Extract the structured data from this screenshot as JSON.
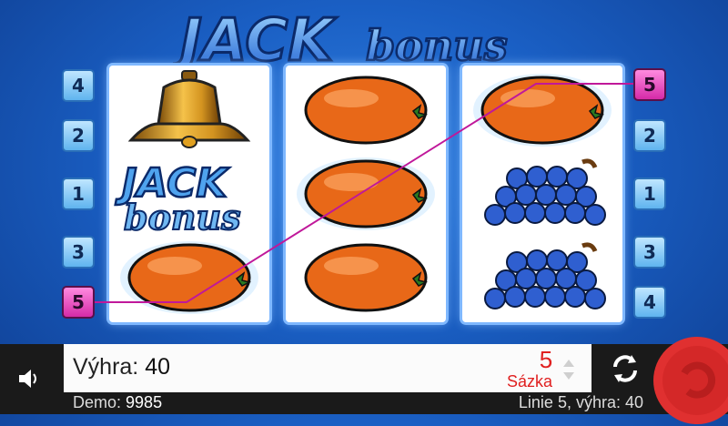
{
  "title": {
    "main": "JACK",
    "sub": "bonus"
  },
  "reels": [
    [
      "bell-icon",
      "jackbonus-logo",
      "orange-icon"
    ],
    [
      "orange-icon",
      "orange-icon",
      "orange-icon"
    ],
    [
      "orange-icon",
      "grapes-icon",
      "grapes-icon"
    ]
  ],
  "left_line_numbers": [
    "4",
    "2",
    "1",
    "3",
    "5"
  ],
  "right_line_numbers": [
    "5",
    "2",
    "1",
    "3",
    "4"
  ],
  "active_line": "5",
  "status": {
    "win_label": "Výhra:",
    "win_value": "40",
    "demo_label": "Demo:",
    "demo_value": "9985",
    "stake_value": "5",
    "stake_label": "Sázka",
    "line_info": "Linie 5, výhra: 40"
  },
  "colors": {
    "background": "#1a5fc4",
    "active_line": "#d52aa8",
    "payline": "#c0189a",
    "spin_button": "#e03030",
    "stake_text": "#e02020"
  }
}
